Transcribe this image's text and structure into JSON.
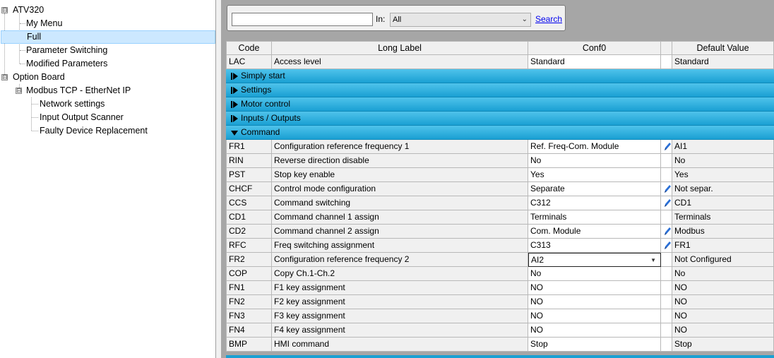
{
  "tree": {
    "items": [
      {
        "label": "ATV320",
        "expander": "⊟"
      },
      {
        "label": "My Menu"
      },
      {
        "label": "Full"
      },
      {
        "label": "Parameter Switching"
      },
      {
        "label": "Modified Parameters"
      },
      {
        "label": "Option Board",
        "expander": "⊟"
      },
      {
        "label": "Modbus TCP - EtherNet IP",
        "expander": "⊟"
      },
      {
        "label": "Network settings"
      },
      {
        "label": "Input Output Scanner"
      },
      {
        "label": "Faulty Device Replacement"
      }
    ]
  },
  "toolbar": {
    "search_value": "",
    "in_label": "In:",
    "in_selected": "All",
    "search_link": "Search"
  },
  "grid": {
    "headers": {
      "code": "Code",
      "long": "Long Label",
      "conf": "Conf0",
      "def": "Default Value"
    },
    "top_row": {
      "code": "LAC",
      "long": "Access level",
      "conf": "Standard",
      "def": "Standard"
    },
    "groups": [
      {
        "label": "Simply start",
        "state": "collapsed"
      },
      {
        "label": "Settings",
        "state": "collapsed"
      },
      {
        "label": "Motor control",
        "state": "collapsed"
      },
      {
        "label": "Inputs / Outputs",
        "state": "collapsed"
      },
      {
        "label": "Command",
        "state": "expanded"
      }
    ],
    "rows": [
      {
        "code": "FR1",
        "long": "Configuration reference frequency 1",
        "conf": "Ref. Freq-Com. Module",
        "edited": true,
        "def": "AI1"
      },
      {
        "code": "RIN",
        "long": "Reverse direction disable",
        "conf": "No",
        "edited": false,
        "def": "No"
      },
      {
        "code": "PST",
        "long": "Stop key enable",
        "conf": "Yes",
        "edited": false,
        "def": "Yes"
      },
      {
        "code": "CHCF",
        "long": "Control mode configuration",
        "conf": "Separate",
        "edited": true,
        "def": "Not separ."
      },
      {
        "code": "CCS",
        "long": "Command switching",
        "conf": "C312",
        "edited": true,
        "def": "CD1"
      },
      {
        "code": "CD1",
        "long": "Command channel 1 assign",
        "conf": "Terminals",
        "edited": false,
        "def": "Terminals"
      },
      {
        "code": "CD2",
        "long": "Command channel 2 assign",
        "conf": "Com. Module",
        "edited": true,
        "def": "Modbus"
      },
      {
        "code": "RFC",
        "long": "Freq switching assignment",
        "conf": "C313",
        "edited": true,
        "def": "FR1"
      },
      {
        "code": "FR2",
        "long": "Configuration reference frequency 2",
        "conf": "AI2",
        "edited": false,
        "dropdown": true,
        "def": "Not Configured"
      },
      {
        "code": "COP",
        "long": "Copy Ch.1-Ch.2",
        "conf": "No",
        "edited": false,
        "def": "No"
      },
      {
        "code": "FN1",
        "long": "F1 key assignment",
        "conf": "NO",
        "edited": false,
        "def": "NO"
      },
      {
        "code": "FN2",
        "long": "F2 key assignment",
        "conf": "NO",
        "edited": false,
        "def": "NO"
      },
      {
        "code": "FN3",
        "long": "F3 key assignment",
        "conf": "NO",
        "edited": false,
        "def": "NO"
      },
      {
        "code": "FN4",
        "long": "F4 key assignment",
        "conf": "NO",
        "edited": false,
        "def": "NO"
      },
      {
        "code": "BMP",
        "long": "HMI command",
        "conf": "Stop",
        "edited": false,
        "def": "Stop"
      }
    ]
  },
  "colors": {
    "group_bar": "#1aa0d3",
    "selection": "#cce8ff",
    "link": "#0000ee",
    "pencil": "#2a6fd6"
  },
  "icons": {
    "collapsed": "play-bar-icon",
    "expanded": "triangle-down-icon",
    "edited": "pencil-icon"
  }
}
